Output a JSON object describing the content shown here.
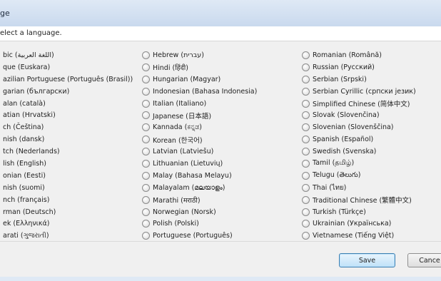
{
  "window": {
    "title": "ge"
  },
  "instruction": "elect a language.",
  "columns": [
    [
      "bic (اللغة العربية)",
      "que (Euskara)",
      "azilian Portuguese (Português (Brasil))",
      "garian (български)",
      "alan (català)",
      "atian (Hrvatski)",
      "ch (Čeština)",
      "nish (dansk)",
      "tch (Nederlands)",
      "lish (English)",
      "onian (Eesti)",
      "nish (suomi)",
      "nch (français)",
      "rman (Deutsch)",
      "ek (Ελληνικά)",
      "arati (ગુજરાતી)"
    ],
    [
      "Hebrew (עברית)",
      "Hindi (हिंदी)",
      "Hungarian (Magyar)",
      "Indonesian (Bahasa Indonesia)",
      "Italian (Italiano)",
      "Japanese (日本語)",
      "Kannada (ಕನ್ನಡ)",
      "Korean (한국어)",
      "Latvian (Latviešu)",
      "Lithuanian (Lietuvių)",
      "Malay (Bahasa Melayu)",
      "Malayalam (മലയാളം)",
      "Marathi (मराठी)",
      "Norwegian (Norsk)",
      "Polish (Polski)",
      "Portuguese (Português)"
    ],
    [
      "Romanian (Română)",
      "Russian (Русский)",
      "Serbian (Srpski)",
      "Serbian Cyrillic (српски језик)",
      "Simplified Chinese (简体中文)",
      "Slovak (Slovenčina)",
      "Slovenian (Slovenščina)",
      "Spanish (Español)",
      "Swedish (Svenska)",
      "Tamil (தமிழ்)",
      "Telugu (తెలుగు)",
      "Thai (ไทย)",
      "Traditional Chinese (繁體中文)",
      "Turkish (Türkçe)",
      "Ukrainian (Українська)",
      "Vietnamese (Tiếng Việt)"
    ]
  ],
  "buttons": {
    "save": "Save",
    "cancel": "Cance"
  }
}
